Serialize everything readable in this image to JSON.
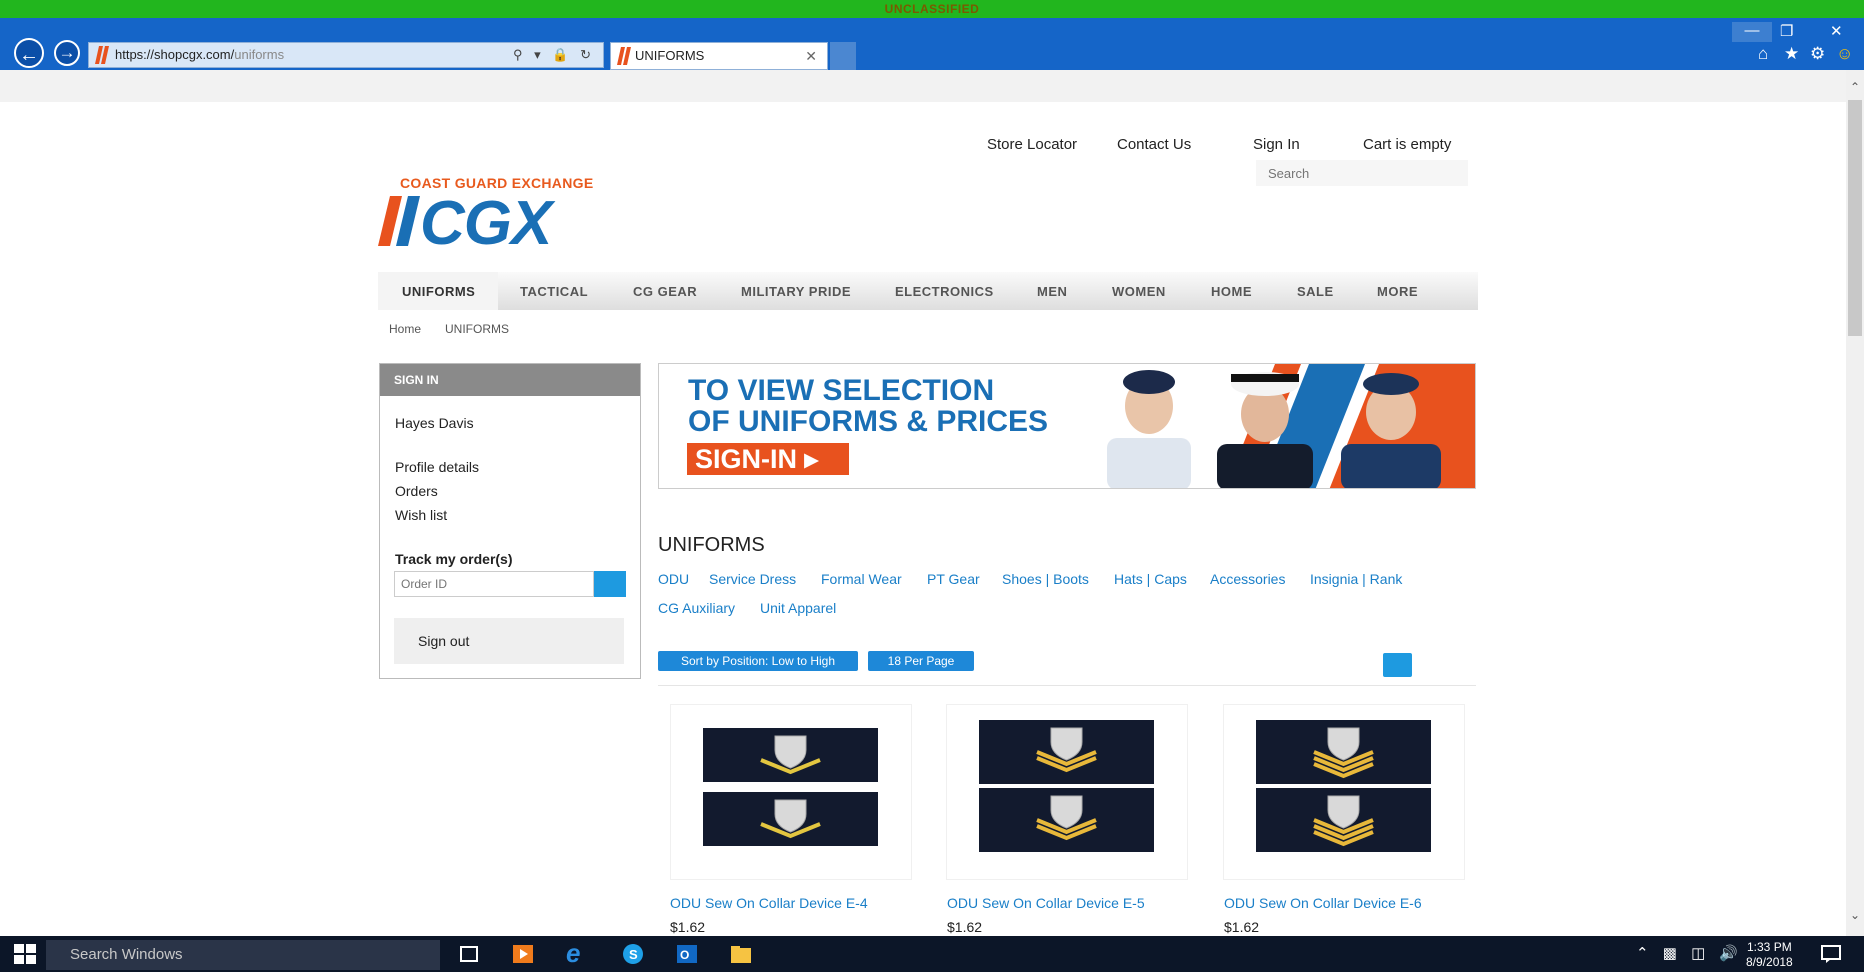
{
  "banner": "UNCLASSIFIED",
  "browser": {
    "url_host": "https://shopcgx.com/",
    "url_path": "uniforms",
    "tab_title": "UNIFORMS"
  },
  "header": {
    "links": [
      "Store Locator",
      "Contact Us",
      "Sign In",
      "Cart is empty"
    ],
    "search_placeholder": "Search"
  },
  "logo": {
    "top_text": "COAST GUARD EXCHANGE",
    "main_text": "CGX"
  },
  "menu": [
    "UNIFORMS",
    "TACTICAL",
    "CG GEAR",
    "MILITARY PRIDE",
    "ELECTRONICS",
    "MEN",
    "WOMEN",
    "HOME",
    "SALE",
    "MORE"
  ],
  "breadcrumb": [
    "Home",
    "UNIFORMS"
  ],
  "sidebar": {
    "title": "SIGN IN",
    "user_name": "Hayes Davis",
    "links": [
      "Profile details",
      "Orders",
      "Wish list"
    ],
    "track_label": "Track my order(s)",
    "order_placeholder": "Order ID",
    "signout": "Sign out"
  },
  "promo": {
    "line1": "TO VIEW SELECTION",
    "line2": "OF UNIFORMS & PRICES",
    "button": "SIGN-IN ▸"
  },
  "section": {
    "title": "UNIFORMS",
    "categories": [
      "ODU",
      "Service Dress",
      "Formal Wear",
      "PT Gear",
      "Shoes | Boots",
      "Hats | Caps",
      "Accessories",
      "Insignia | Rank",
      "CG Auxiliary",
      "Unit Apparel"
    ],
    "sort_label": "Sort by Position: Low to High",
    "per_page_label": "18 Per Page"
  },
  "products": [
    {
      "title": "ODU Sew On Collar Device E-4",
      "price": "$1.62",
      "chevrons": 1
    },
    {
      "title": "ODU Sew On Collar Device E-5",
      "price": "$1.62",
      "chevrons": 2
    },
    {
      "title": "ODU Sew On Collar Device E-6",
      "price": "$1.62",
      "chevrons": 3
    }
  ],
  "taskbar": {
    "search_placeholder": "Search Windows",
    "time": "1:33 PM",
    "date": "8/9/2018"
  },
  "colors": {
    "banner": "#22b61e",
    "chrome": "#1565c8",
    "link": "#1a7fc8",
    "accent_orange": "#e8521e",
    "logo_blue": "#1a6fb5"
  }
}
